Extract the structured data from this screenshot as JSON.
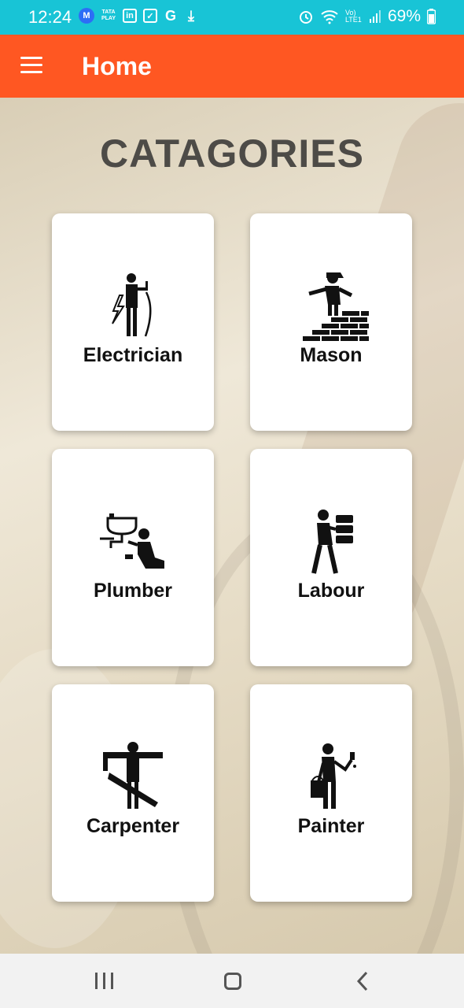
{
  "status_bar": {
    "time": "12:24",
    "tata_play": "TATA PLAY",
    "battery": "69%",
    "network": "Vo) LTE1",
    "icons": [
      "m-app-icon",
      "tata-play-icon",
      "linkedin-icon",
      "check-icon",
      "google-icon",
      "download-icon",
      "alarm-icon",
      "wifi-icon",
      "signal-icon",
      "battery-icon"
    ]
  },
  "app_bar": {
    "title": "Home",
    "menu_icon": "hamburger-menu-icon"
  },
  "colors": {
    "status_bar": "#18c4d6",
    "app_bar": "#ff5722",
    "title_text": "#4d4b47"
  },
  "main": {
    "heading": "CATAGORIES",
    "categories": [
      {
        "label": "Electrician",
        "icon": "electrician-icon"
      },
      {
        "label": "Mason",
        "icon": "mason-icon"
      },
      {
        "label": "Plumber",
        "icon": "plumber-icon"
      },
      {
        "label": "Labour",
        "icon": "labour-icon"
      },
      {
        "label": "Carpenter",
        "icon": "carpenter-icon"
      },
      {
        "label": "Painter",
        "icon": "painter-icon"
      }
    ]
  },
  "nav_bar": {
    "icons": [
      "recent-apps-icon",
      "home-icon",
      "back-icon"
    ]
  }
}
